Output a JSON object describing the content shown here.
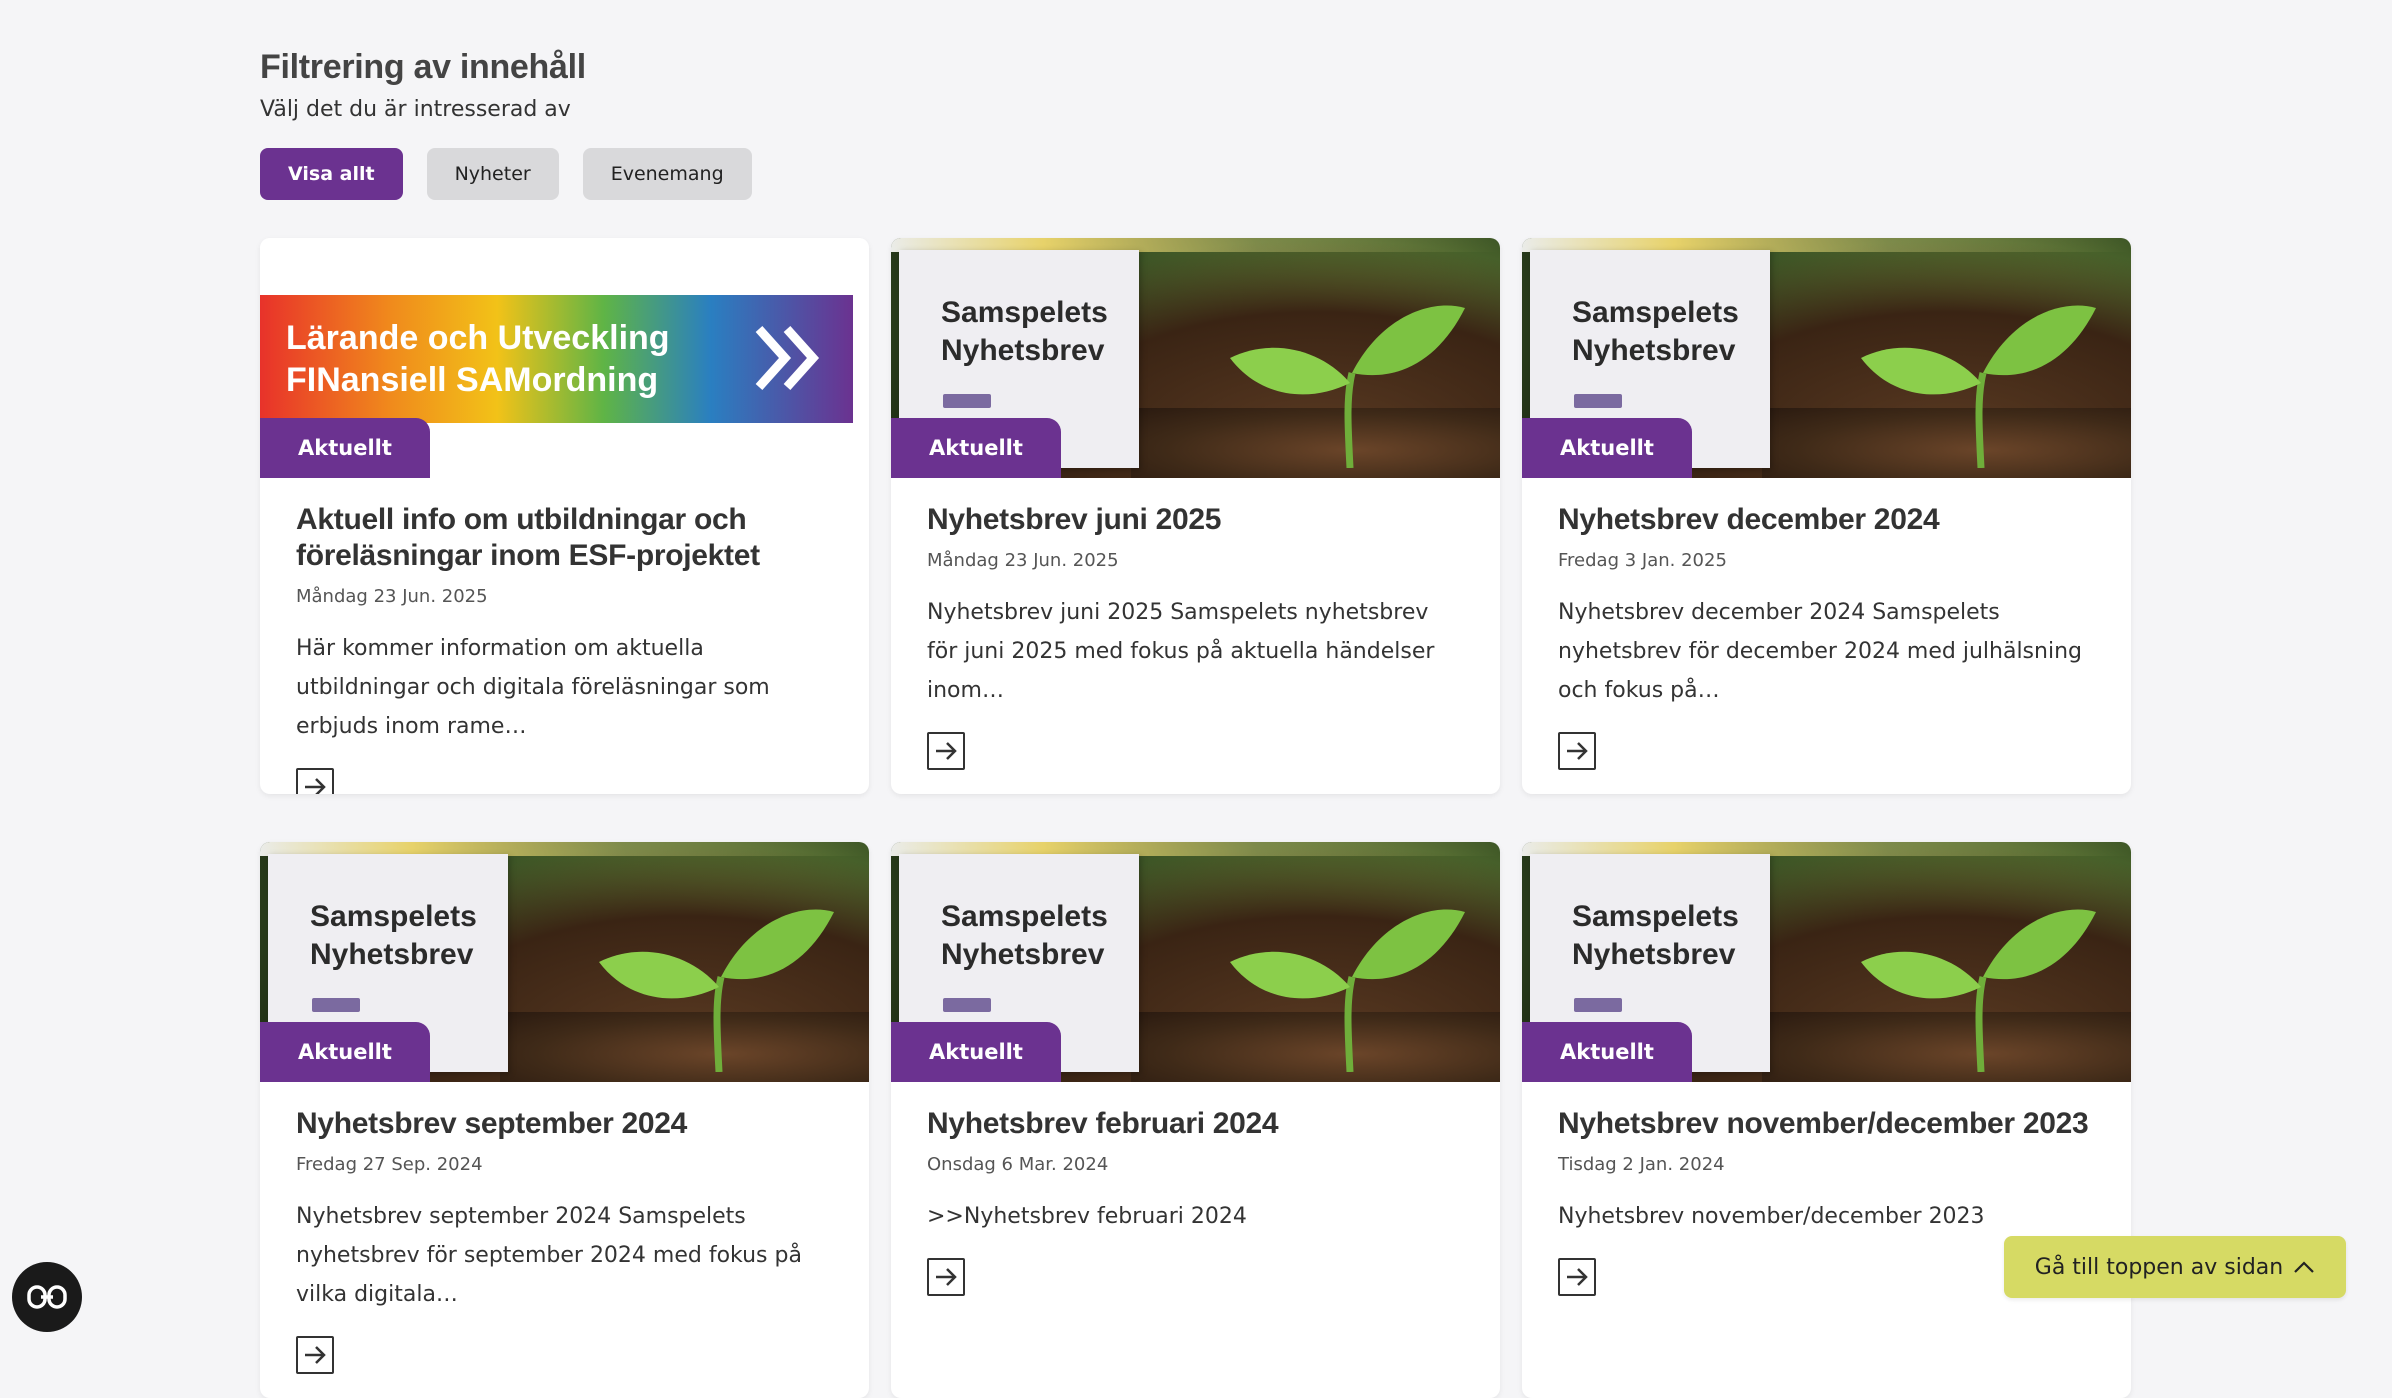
{
  "filter": {
    "title": "Filtrering av innehåll",
    "subtitle": "Välj det du är intresserad av",
    "buttons": [
      {
        "label": "Visa allt",
        "active": true
      },
      {
        "label": "Nyheter",
        "active": false
      },
      {
        "label": "Evenemang",
        "active": false
      }
    ]
  },
  "cards": [
    {
      "tag": "Aktuellt",
      "image": "banner",
      "image_text_line1": "Lärande och Utveckling",
      "image_text_line2": "FINansiell SAMordning",
      "title": "Aktuell info om utbildningar och föreläsningar inom ESF-projektet",
      "date": "Måndag 23 Jun. 2025",
      "excerpt": "Här kommer information om aktuella utbildningar och digitala föreläsningar som erbjuds inom rame…"
    },
    {
      "tag": "Aktuellt",
      "image": "newsletter",
      "image_text_line1": "Samspelets",
      "image_text_line2": "Nyhetsbrev",
      "title": "Nyhetsbrev juni 2025",
      "date": "Måndag 23 Jun. 2025",
      "excerpt": "Nyhetsbrev juni 2025 Samspelets nyhetsbrev för juni 2025 med fokus på aktuella händelser inom…"
    },
    {
      "tag": "Aktuellt",
      "image": "newsletter",
      "image_text_line1": "Samspelets",
      "image_text_line2": "Nyhetsbrev",
      "title": "Nyhetsbrev december 2024",
      "date": "Fredag 3 Jan. 2025",
      "excerpt": "Nyhetsbrev december 2024 Samspelets nyhetsbrev för december 2024 med julhälsning och fokus på…"
    },
    {
      "tag": "Aktuellt",
      "image": "newsletter",
      "image_text_line1": "Samspelets",
      "image_text_line2": "Nyhetsbrev",
      "title": "Nyhetsbrev september 2024",
      "date": "Fredag 27 Sep. 2024",
      "excerpt": "Nyhetsbrev september 2024 Samspelets nyhetsbrev för september 2024 med fokus på vilka digitala…"
    },
    {
      "tag": "Aktuellt",
      "image": "newsletter",
      "image_text_line1": "Samspelets",
      "image_text_line2": "Nyhetsbrev",
      "title": "Nyhetsbrev februari 2024",
      "date": "Onsdag 6 Mar. 2024",
      "excerpt": ">>Nyhetsbrev februari 2024"
    },
    {
      "tag": "Aktuellt",
      "image": "newsletter",
      "image_text_line1": "Samspelets",
      "image_text_line2": "Nyhetsbrev",
      "title": "Nyhetsbrev november/december 2023",
      "date": "Tisdag 2 Jan. 2024",
      "excerpt": "Nyhetsbrev november/december 2023"
    }
  ],
  "back_to_top": {
    "label": "Gå till toppen av sidan",
    "icon": "chevron-up-icon"
  },
  "accessibility": {
    "icon": "accessibility-icon"
  },
  "colors": {
    "accent": "#6b3290",
    "to_top": "#d6da64",
    "page_bg": "#f5f5f7"
  }
}
